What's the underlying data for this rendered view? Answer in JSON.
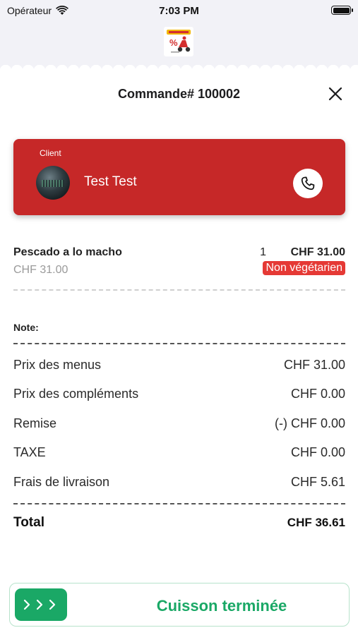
{
  "status_bar": {
    "carrier": "Opérateur",
    "time": "7:03 PM"
  },
  "header": {
    "title": "Commande# 100002"
  },
  "client": {
    "label": "Client",
    "name": "Test Test"
  },
  "item": {
    "name": "Pescado a lo macho",
    "unit_price": "CHF 31.00",
    "quantity": "1",
    "price": "CHF 31.00",
    "badge": "Non végétarien"
  },
  "note": {
    "label": "Note:"
  },
  "summary": [
    {
      "label": "Prix des menus",
      "value": "CHF 31.00"
    },
    {
      "label": "Prix des compléments",
      "value": "CHF 0.00"
    },
    {
      "label": "Remise",
      "value": "(-) CHF 0.00"
    },
    {
      "label": "TAXE",
      "value": "CHF 0.00"
    },
    {
      "label": "Frais de livraison",
      "value": "CHF 5.61"
    }
  ],
  "total": {
    "label": "Total",
    "value": "CHF 36.61"
  },
  "action": {
    "label": "Cuisson terminée"
  },
  "colors": {
    "client_card": "#c62828",
    "badge": "#e53935",
    "action_green": "#1aa866"
  }
}
